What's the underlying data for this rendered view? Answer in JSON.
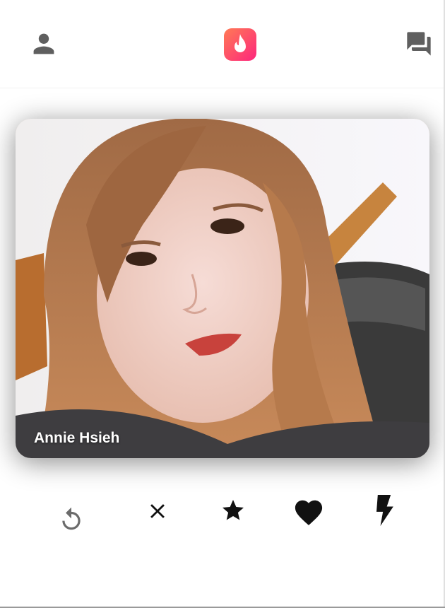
{
  "header": {
    "profile_icon": "person-icon",
    "logo_icon": "flame-logo-icon",
    "messages_icon": "chat-icon",
    "brand_gradient": [
      "#ff5864",
      "#fd267d"
    ]
  },
  "card": {
    "name": "Annie Hsieh",
    "photo": "profile-photo"
  },
  "actions": [
    {
      "id": "rewind",
      "icon": "undo-icon",
      "color": "#6b6b6b"
    },
    {
      "id": "nope",
      "icon": "close-icon",
      "color": "#111111"
    },
    {
      "id": "super-like",
      "icon": "star-icon",
      "color": "#111111"
    },
    {
      "id": "like",
      "icon": "heart-icon",
      "color": "#111111"
    },
    {
      "id": "boost",
      "icon": "lightning-icon",
      "color": "#111111"
    }
  ]
}
